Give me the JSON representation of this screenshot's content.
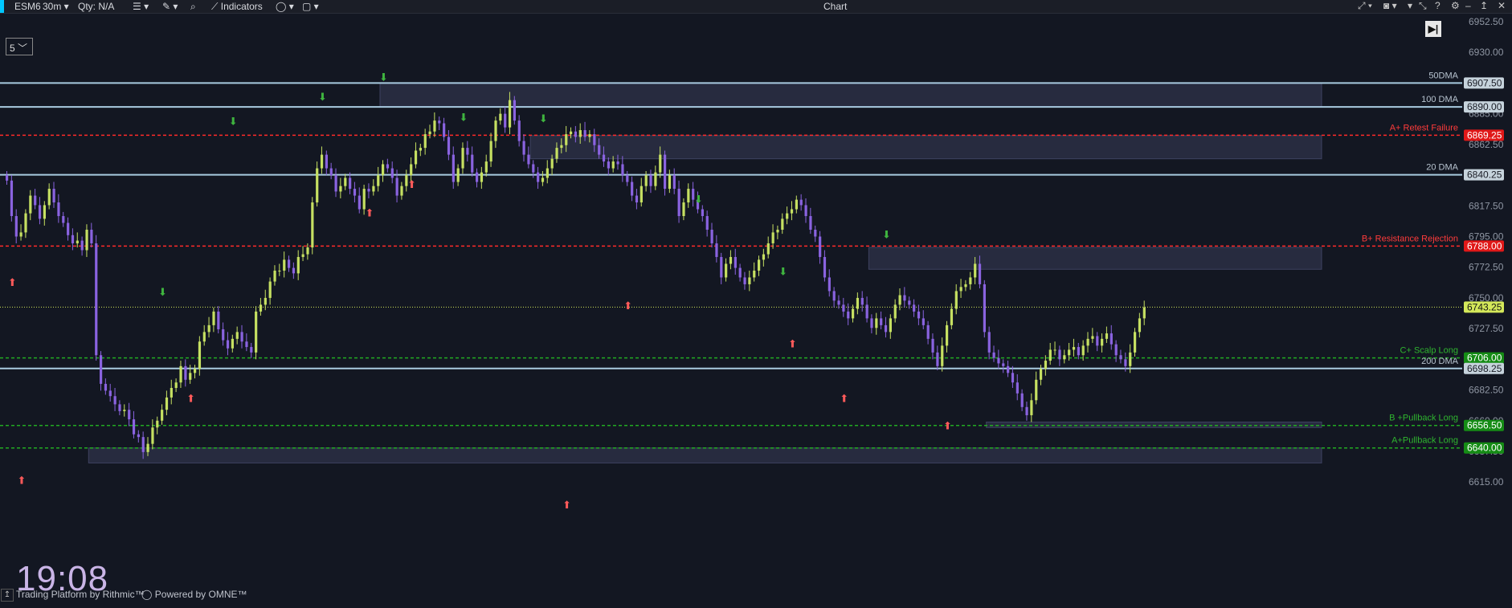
{
  "toolbar": {
    "symbol": "ESM6",
    "timeframe": "30m",
    "qty": "Qty: N/A",
    "indicators_label": "Indicators",
    "window_title": "Chart"
  },
  "chart_controls": {
    "interval_select": "5"
  },
  "clock": "19:08",
  "footer": {
    "source": "Trading Platform by Rithmic™",
    "powered_by": "Powered by OMNE™"
  },
  "colors": {
    "background": "#131722",
    "up_candle": "#c6e062",
    "down_candle": "#8a63e0",
    "ma_line": "#a9cbe0",
    "resistance": "#ff2a2a",
    "support": "#22aa22",
    "zone": "#2c2f44",
    "current_price": "#d4e85a"
  },
  "chart_data": {
    "type": "candlestick",
    "instrument": "ESM6",
    "interval": "30m",
    "ylim": [
      6605,
      6957
    ],
    "y_ticks": [
      "6952.50",
      "6930.00",
      "6907.50",
      "6885.00",
      "6862.50",
      "6840.00",
      "6817.50",
      "6795.00",
      "6772.50",
      "6750.00",
      "6727.50",
      "6705.00",
      "6682.50",
      "6660.00",
      "6637.50",
      "6615.00"
    ],
    "current_price": "6743.25",
    "levels": [
      {
        "label": "50DMA",
        "price": "6907.50",
        "style": "ma"
      },
      {
        "label": "100 DMA",
        "price": "6890.00",
        "style": "ma"
      },
      {
        "label": "A+ Retest Failure",
        "price": "6869.25",
        "style": "resistance"
      },
      {
        "label": "20 DMA",
        "price": "6840.25",
        "style": "ma"
      },
      {
        "label": "B+ Resistance Rejection",
        "price": "6788.00",
        "style": "resistance"
      },
      {
        "label": "C+ Scalp Long",
        "price": "6706.00",
        "style": "support"
      },
      {
        "label": "200 DMA",
        "price": "6698.25",
        "style": "ma"
      },
      {
        "label": "B +Pullback Long",
        "price": "6656.50",
        "style": "support"
      },
      {
        "label": "A+Pullback Long",
        "price": "6640.00",
        "style": "support"
      }
    ],
    "zones": [
      {
        "from_bar": 80,
        "to_bar": 280,
        "top": 6907.5,
        "bottom": 6890
      },
      {
        "from_bar": 112,
        "to_bar": 280,
        "top": 6869,
        "bottom": 6852
      },
      {
        "from_bar": 184,
        "to_bar": 280,
        "top": 6787,
        "bottom": 6771
      },
      {
        "from_bar": 209,
        "to_bar": 280,
        "top": 6659,
        "bottom": 6655
      },
      {
        "from_bar": 18,
        "to_bar": 280,
        "top": 6640,
        "bottom": 6629
      }
    ],
    "bar_count": 218,
    "closes": [
      6836,
      6810,
      6795,
      6798,
      6812,
      6825,
      6818,
      6808,
      6818,
      6830,
      6820,
      6810,
      6805,
      6796,
      6790,
      6792,
      6785,
      6800,
      6790,
      6708,
      6687,
      6682,
      6678,
      6672,
      6667,
      6668,
      6661,
      6650,
      6648,
      6637,
      6643,
      6655,
      6660,
      6668,
      6677,
      6684,
      6688,
      6700,
      6690,
      6695,
      6698,
      6718,
      6725,
      6730,
      6740,
      6727,
      6719,
      6713,
      6720,
      6725,
      6718,
      6714,
      6710,
      6740,
      6745,
      6750,
      6762,
      6770,
      6770,
      6778,
      6772,
      6768,
      6780,
      6782,
      6787,
      6820,
      6845,
      6855,
      6845,
      6840,
      6828,
      6832,
      6838,
      6830,
      6825,
      6815,
      6830,
      6828,
      6832,
      6840,
      6848,
      6845,
      6838,
      6825,
      6832,
      6840,
      6848,
      6858,
      6860,
      6870,
      6872,
      6880,
      6878,
      6868,
      6855,
      6835,
      6845,
      6860,
      6855,
      6842,
      6835,
      6842,
      6850,
      6865,
      6880,
      6885,
      6875,
      6895,
      6880,
      6865,
      6855,
      6848,
      6842,
      6835,
      6838,
      6845,
      6852,
      6860,
      6862,
      6870,
      6872,
      6868,
      6873,
      6868,
      6870,
      6862,
      6855,
      6850,
      6845,
      6850,
      6848,
      6840,
      6835,
      6825,
      6820,
      6832,
      6840,
      6832,
      6842,
      6855,
      6830,
      6840,
      6830,
      6810,
      6820,
      6830,
      6822,
      6815,
      6810,
      6800,
      6790,
      6780,
      6765,
      6775,
      6780,
      6772,
      6765,
      6760,
      6765,
      6770,
      6778,
      6782,
      6790,
      6798,
      6800,
      6808,
      6812,
      6815,
      6822,
      6818,
      6810,
      6800,
      6795,
      6780,
      6765,
      6755,
      6748,
      6745,
      6740,
      6735,
      6742,
      6750,
      6745,
      6735,
      6728,
      6735,
      6730,
      6725,
      6735,
      6745,
      6752,
      6748,
      6745,
      6740,
      6735,
      6730,
      6720,
      6710,
      6700,
      6715,
      6730,
      6742,
      6755,
      6758,
      6760,
      6765,
      6775,
      6760,
      6725,
      6710,
      6706,
      6702,
      6700,
      6695,
      6688,
      6680,
      6670,
      6664,
      6675,
      6690,
      6698,
      6704,
      6712,
      6712,
      6705,
      6708,
      6712,
      6714,
      6708,
      6715,
      6720,
      6722,
      6715,
      6720,
      6724,
      6716,
      6708,
      6705,
      6700,
      6710,
      6725,
      6735,
      6743
    ]
  }
}
